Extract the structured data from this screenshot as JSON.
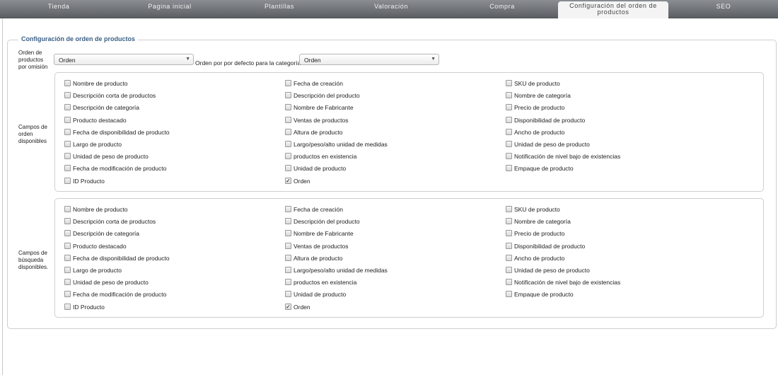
{
  "tabs": [
    {
      "label": "Tienda",
      "active": false
    },
    {
      "label": "Pagina inicial",
      "active": false
    },
    {
      "label": "Plantillas",
      "active": false
    },
    {
      "label": "Valoración",
      "active": false
    },
    {
      "label": "Compra",
      "active": false
    },
    {
      "label": "Configuración del orden de productos",
      "active": true
    },
    {
      "label": "SEO",
      "active": false
    }
  ],
  "section_title": "Configuración de orden de productos",
  "default_order": {
    "label": "Orden de productos por omisión",
    "value": "Orden"
  },
  "category_order": {
    "label": "Orden por por defecto para la categoría",
    "value": "Orden"
  },
  "sort_fields": {
    "label": "Campos de orden disponibles",
    "columns": [
      [
        {
          "label": "Nombre de producto",
          "checked": false
        },
        {
          "label": "Descripción corta de productos",
          "checked": false
        },
        {
          "label": "Descripción de categoría",
          "checked": false
        },
        {
          "label": "Producto destacado",
          "checked": false
        },
        {
          "label": "Fecha de disponibilidad de producto",
          "checked": false
        },
        {
          "label": "Largo de producto",
          "checked": false
        },
        {
          "label": "Unidad de peso de producto",
          "checked": false
        },
        {
          "label": "Fecha de modificación de producto",
          "checked": false
        },
        {
          "label": "ID Producto",
          "checked": false
        }
      ],
      [
        {
          "label": "Fecha de creación",
          "checked": false
        },
        {
          "label": "Descripción del producto",
          "checked": false
        },
        {
          "label": "Nombre de Fabricante",
          "checked": false
        },
        {
          "label": "Ventas de productos",
          "checked": false
        },
        {
          "label": "Altura de producto",
          "checked": false
        },
        {
          "label": "Largo/peso/alto unidad de medidas",
          "checked": false
        },
        {
          "label": "productos en existencia",
          "checked": false
        },
        {
          "label": "Unidad de producto",
          "checked": false
        },
        {
          "label": "Orden",
          "checked": true
        }
      ],
      [
        {
          "label": "SKU de producto",
          "checked": false
        },
        {
          "label": "Nombre de categoría",
          "checked": false
        },
        {
          "label": "Precio de producto",
          "checked": false
        },
        {
          "label": "Disponibilidad de producto",
          "checked": false
        },
        {
          "label": "Ancho de producto",
          "checked": false
        },
        {
          "label": "Unidad de peso de producto",
          "checked": false
        },
        {
          "label": "Notificación de nivel bajo de existencias",
          "checked": false
        },
        {
          "label": "Empaque de producto",
          "checked": false
        }
      ]
    ]
  },
  "search_fields": {
    "label": "Campos de búsqueda disponibles.",
    "columns": [
      [
        {
          "label": "Nombre de producto",
          "checked": false
        },
        {
          "label": "Descripción corta de productos",
          "checked": false
        },
        {
          "label": "Descripción de categoría",
          "checked": false
        },
        {
          "label": "Producto destacado",
          "checked": false
        },
        {
          "label": "Fecha de disponibilidad de producto",
          "checked": false
        },
        {
          "label": "Largo de producto",
          "checked": false
        },
        {
          "label": "Unidad de peso de producto",
          "checked": false
        },
        {
          "label": "Fecha de modificación de producto",
          "checked": false
        },
        {
          "label": "ID Producto",
          "checked": false
        }
      ],
      [
        {
          "label": "Fecha de creación",
          "checked": false
        },
        {
          "label": "Descripción del producto",
          "checked": false
        },
        {
          "label": "Nombre de Fabricante",
          "checked": false
        },
        {
          "label": "Ventas de productos",
          "checked": false
        },
        {
          "label": "Altura de producto",
          "checked": false
        },
        {
          "label": "Largo/peso/alto unidad de medidas",
          "checked": false
        },
        {
          "label": "productos en existencia",
          "checked": false
        },
        {
          "label": "Unidad de producto",
          "checked": false
        },
        {
          "label": "Orden",
          "checked": true
        }
      ],
      [
        {
          "label": "SKU de producto",
          "checked": false
        },
        {
          "label": "Nombre de categoría",
          "checked": false
        },
        {
          "label": "Precio de producto",
          "checked": false
        },
        {
          "label": "Disponibilidad de producto",
          "checked": false
        },
        {
          "label": "Ancho de producto",
          "checked": false
        },
        {
          "label": "Unidad de peso de producto",
          "checked": false
        },
        {
          "label": "Notificación de nivel bajo de existencias",
          "checked": false
        },
        {
          "label": "Empaque de producto",
          "checked": false
        }
      ]
    ]
  }
}
